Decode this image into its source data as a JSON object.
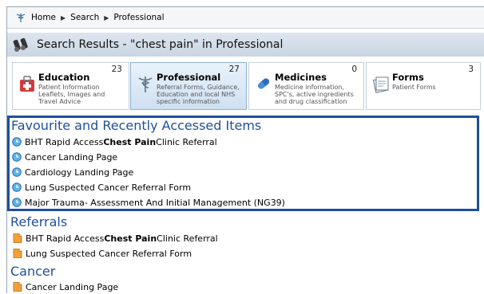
{
  "breadcrumb": {
    "items": [
      "Home",
      "Search",
      "Professional"
    ]
  },
  "search_header": {
    "title": "Search Results - \"chest pain\" in Professional"
  },
  "tiles": [
    {
      "name": "Education",
      "count": "23",
      "desc": [
        "Patient Information",
        "Leaflets, Images and",
        "Travel Advice"
      ]
    },
    {
      "name": "Professional",
      "count": "27",
      "desc": [
        "Referral Forms, Guidance,",
        "Education and local NHS",
        "specific information"
      ]
    },
    {
      "name": "Medicines",
      "count": "0",
      "desc": [
        "Medicine information,",
        "SPC's, active ingredients",
        "and drug classification"
      ]
    },
    {
      "name": "Forms",
      "count": "3",
      "desc": [
        "Patient Forms"
      ]
    }
  ],
  "favourites": {
    "heading": "Favourite and Recently Accessed Items",
    "items": [
      {
        "pre": "BHT Rapid Access ",
        "bold": "Chest Pain",
        "post": " Clinic Referral"
      },
      {
        "pre": "Cancer Landing Page",
        "bold": "",
        "post": ""
      },
      {
        "pre": "Cardiology Landing Page",
        "bold": "",
        "post": ""
      },
      {
        "pre": "Lung Suspected Cancer Referral Form",
        "bold": "",
        "post": ""
      },
      {
        "pre": "Major Trauma- Assessment And Initial Management (NG39)",
        "bold": "",
        "post": ""
      }
    ]
  },
  "referrals": {
    "heading": "Referrals",
    "items": [
      {
        "pre": "BHT Rapid Access ",
        "bold": "Chest Pain",
        "post": " Clinic Referral"
      },
      {
        "pre": "Lung Suspected Cancer Referral Form",
        "bold": "",
        "post": ""
      }
    ]
  },
  "cancer": {
    "heading": "Cancer",
    "items": [
      {
        "pre": "Cancer Landing Page",
        "bold": "",
        "post": ""
      }
    ]
  }
}
